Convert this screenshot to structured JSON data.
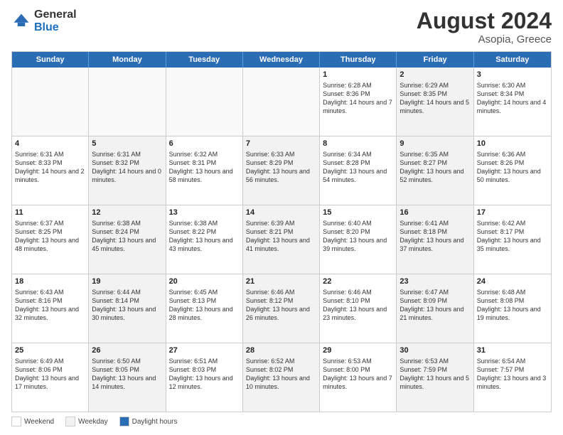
{
  "header": {
    "logo_line1": "General",
    "logo_line2": "Blue",
    "main_title": "August 2024",
    "subtitle": "Asopia, Greece"
  },
  "calendar": {
    "days_of_week": [
      "Sunday",
      "Monday",
      "Tuesday",
      "Wednesday",
      "Thursday",
      "Friday",
      "Saturday"
    ],
    "weeks": [
      [
        {
          "day": "",
          "info": "",
          "shaded": false,
          "empty": true
        },
        {
          "day": "",
          "info": "",
          "shaded": false,
          "empty": true
        },
        {
          "day": "",
          "info": "",
          "shaded": false,
          "empty": true
        },
        {
          "day": "",
          "info": "",
          "shaded": false,
          "empty": true
        },
        {
          "day": "1",
          "info": "Sunrise: 6:28 AM\nSunset: 8:36 PM\nDaylight: 14 hours and 7 minutes.",
          "shaded": false,
          "empty": false
        },
        {
          "day": "2",
          "info": "Sunrise: 6:29 AM\nSunset: 8:35 PM\nDaylight: 14 hours and 5 minutes.",
          "shaded": true,
          "empty": false
        },
        {
          "day": "3",
          "info": "Sunrise: 6:30 AM\nSunset: 8:34 PM\nDaylight: 14 hours and 4 minutes.",
          "shaded": false,
          "empty": false
        }
      ],
      [
        {
          "day": "4",
          "info": "Sunrise: 6:31 AM\nSunset: 8:33 PM\nDaylight: 14 hours and 2 minutes.",
          "shaded": false,
          "empty": false
        },
        {
          "day": "5",
          "info": "Sunrise: 6:31 AM\nSunset: 8:32 PM\nDaylight: 14 hours and 0 minutes.",
          "shaded": true,
          "empty": false
        },
        {
          "day": "6",
          "info": "Sunrise: 6:32 AM\nSunset: 8:31 PM\nDaylight: 13 hours and 58 minutes.",
          "shaded": false,
          "empty": false
        },
        {
          "day": "7",
          "info": "Sunrise: 6:33 AM\nSunset: 8:29 PM\nDaylight: 13 hours and 56 minutes.",
          "shaded": true,
          "empty": false
        },
        {
          "day": "8",
          "info": "Sunrise: 6:34 AM\nSunset: 8:28 PM\nDaylight: 13 hours and 54 minutes.",
          "shaded": false,
          "empty": false
        },
        {
          "day": "9",
          "info": "Sunrise: 6:35 AM\nSunset: 8:27 PM\nDaylight: 13 hours and 52 minutes.",
          "shaded": true,
          "empty": false
        },
        {
          "day": "10",
          "info": "Sunrise: 6:36 AM\nSunset: 8:26 PM\nDaylight: 13 hours and 50 minutes.",
          "shaded": false,
          "empty": false
        }
      ],
      [
        {
          "day": "11",
          "info": "Sunrise: 6:37 AM\nSunset: 8:25 PM\nDaylight: 13 hours and 48 minutes.",
          "shaded": false,
          "empty": false
        },
        {
          "day": "12",
          "info": "Sunrise: 6:38 AM\nSunset: 8:24 PM\nDaylight: 13 hours and 45 minutes.",
          "shaded": true,
          "empty": false
        },
        {
          "day": "13",
          "info": "Sunrise: 6:38 AM\nSunset: 8:22 PM\nDaylight: 13 hours and 43 minutes.",
          "shaded": false,
          "empty": false
        },
        {
          "day": "14",
          "info": "Sunrise: 6:39 AM\nSunset: 8:21 PM\nDaylight: 13 hours and 41 minutes.",
          "shaded": true,
          "empty": false
        },
        {
          "day": "15",
          "info": "Sunrise: 6:40 AM\nSunset: 8:20 PM\nDaylight: 13 hours and 39 minutes.",
          "shaded": false,
          "empty": false
        },
        {
          "day": "16",
          "info": "Sunrise: 6:41 AM\nSunset: 8:18 PM\nDaylight: 13 hours and 37 minutes.",
          "shaded": true,
          "empty": false
        },
        {
          "day": "17",
          "info": "Sunrise: 6:42 AM\nSunset: 8:17 PM\nDaylight: 13 hours and 35 minutes.",
          "shaded": false,
          "empty": false
        }
      ],
      [
        {
          "day": "18",
          "info": "Sunrise: 6:43 AM\nSunset: 8:16 PM\nDaylight: 13 hours and 32 minutes.",
          "shaded": false,
          "empty": false
        },
        {
          "day": "19",
          "info": "Sunrise: 6:44 AM\nSunset: 8:14 PM\nDaylight: 13 hours and 30 minutes.",
          "shaded": true,
          "empty": false
        },
        {
          "day": "20",
          "info": "Sunrise: 6:45 AM\nSunset: 8:13 PM\nDaylight: 13 hours and 28 minutes.",
          "shaded": false,
          "empty": false
        },
        {
          "day": "21",
          "info": "Sunrise: 6:46 AM\nSunset: 8:12 PM\nDaylight: 13 hours and 26 minutes.",
          "shaded": true,
          "empty": false
        },
        {
          "day": "22",
          "info": "Sunrise: 6:46 AM\nSunset: 8:10 PM\nDaylight: 13 hours and 23 minutes.",
          "shaded": false,
          "empty": false
        },
        {
          "day": "23",
          "info": "Sunrise: 6:47 AM\nSunset: 8:09 PM\nDaylight: 13 hours and 21 minutes.",
          "shaded": true,
          "empty": false
        },
        {
          "day": "24",
          "info": "Sunrise: 6:48 AM\nSunset: 8:08 PM\nDaylight: 13 hours and 19 minutes.",
          "shaded": false,
          "empty": false
        }
      ],
      [
        {
          "day": "25",
          "info": "Sunrise: 6:49 AM\nSunset: 8:06 PM\nDaylight: 13 hours and 17 minutes.",
          "shaded": false,
          "empty": false
        },
        {
          "day": "26",
          "info": "Sunrise: 6:50 AM\nSunset: 8:05 PM\nDaylight: 13 hours and 14 minutes.",
          "shaded": true,
          "empty": false
        },
        {
          "day": "27",
          "info": "Sunrise: 6:51 AM\nSunset: 8:03 PM\nDaylight: 13 hours and 12 minutes.",
          "shaded": false,
          "empty": false
        },
        {
          "day": "28",
          "info": "Sunrise: 6:52 AM\nSunset: 8:02 PM\nDaylight: 13 hours and 10 minutes.",
          "shaded": true,
          "empty": false
        },
        {
          "day": "29",
          "info": "Sunrise: 6:53 AM\nSunset: 8:00 PM\nDaylight: 13 hours and 7 minutes.",
          "shaded": false,
          "empty": false
        },
        {
          "day": "30",
          "info": "Sunrise: 6:53 AM\nSunset: 7:59 PM\nDaylight: 13 hours and 5 minutes.",
          "shaded": true,
          "empty": false
        },
        {
          "day": "31",
          "info": "Sunrise: 6:54 AM\nSunset: 7:57 PM\nDaylight: 13 hours and 3 minutes.",
          "shaded": false,
          "empty": false
        }
      ]
    ]
  },
  "legend": {
    "items": [
      {
        "color": "white",
        "label": "Weekend"
      },
      {
        "color": "gray",
        "label": "Weekday"
      },
      {
        "color": "blue",
        "label": "Daylight hours"
      }
    ],
    "daylight_label": "Daylight hours"
  }
}
